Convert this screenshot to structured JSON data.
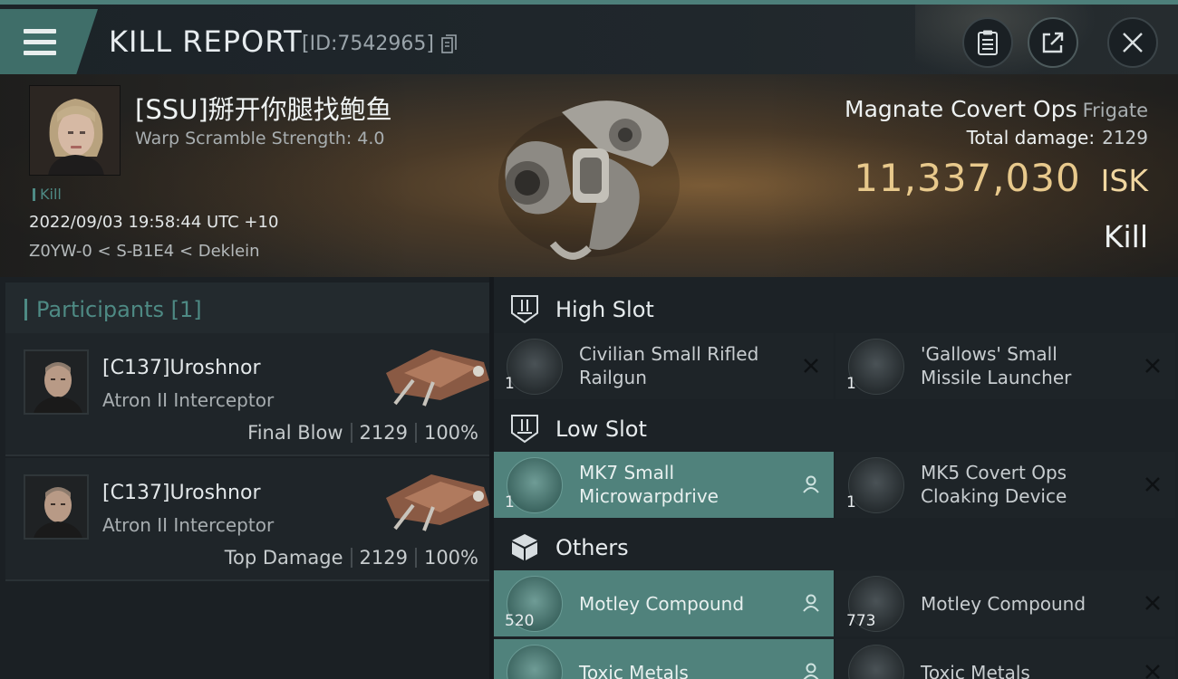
{
  "header": {
    "title": "KILL REPORT",
    "report_id": "[ID:7542965]"
  },
  "victim": {
    "name": "[SSU]掰开你腿找鲍鱼",
    "warp_scramble": "Warp Scramble Strength: 4.0",
    "tag": "Kill",
    "datetime": "2022/09/03 19:58:44 UTC +10",
    "location": "Z0YW-0 < S-B1E4 < Deklein",
    "ship_name": "Magnate Covert Ops",
    "ship_class": "Frigate",
    "total_damage_label": "Total damage:",
    "total_damage_value": "2129",
    "isk_value": "11,337,030",
    "isk_unit": "ISK",
    "result": "Kill"
  },
  "participants": {
    "header": "Participants [1]",
    "items": [
      {
        "name": "[C137]Uroshnor",
        "ship": "Atron II Interceptor",
        "role": "Final Blow",
        "damage": "2129",
        "percent": "100%"
      },
      {
        "name": "[C137]Uroshnor",
        "ship": "Atron II Interceptor",
        "role": "Top Damage",
        "damage": "2129",
        "percent": "100%"
      }
    ]
  },
  "fitting": {
    "high_slot": {
      "label": "High Slot",
      "items": [
        {
          "name": "Civilian Small Rifled Railgun",
          "qty": "1",
          "highlighted": false,
          "status": "destroyed"
        },
        {
          "name": "'Gallows' Small Missile Launcher",
          "qty": "1",
          "highlighted": false,
          "status": "destroyed"
        }
      ]
    },
    "low_slot": {
      "label": "Low Slot",
      "items": [
        {
          "name": "MK7 Small Microwarpdrive",
          "qty": "1",
          "highlighted": true,
          "status": "dropped"
        },
        {
          "name": "MK5 Covert Ops Cloaking Device",
          "qty": "1",
          "highlighted": false,
          "status": "destroyed"
        }
      ]
    },
    "others": {
      "label": "Others",
      "items": [
        {
          "name": "Motley Compound",
          "qty": "520",
          "highlighted": true,
          "status": "dropped"
        },
        {
          "name": "Motley Compound",
          "qty": "773",
          "highlighted": false,
          "status": "destroyed"
        },
        {
          "name": "Toxic Metals",
          "qty": "",
          "highlighted": true,
          "status": "dropped"
        },
        {
          "name": "Toxic Metals",
          "qty": "",
          "highlighted": false,
          "status": "destroyed"
        }
      ]
    }
  },
  "colors": {
    "accent_teal": "#4e8a84",
    "highlight_slot": "#50827c",
    "isk_gold": "#e8c98c"
  }
}
